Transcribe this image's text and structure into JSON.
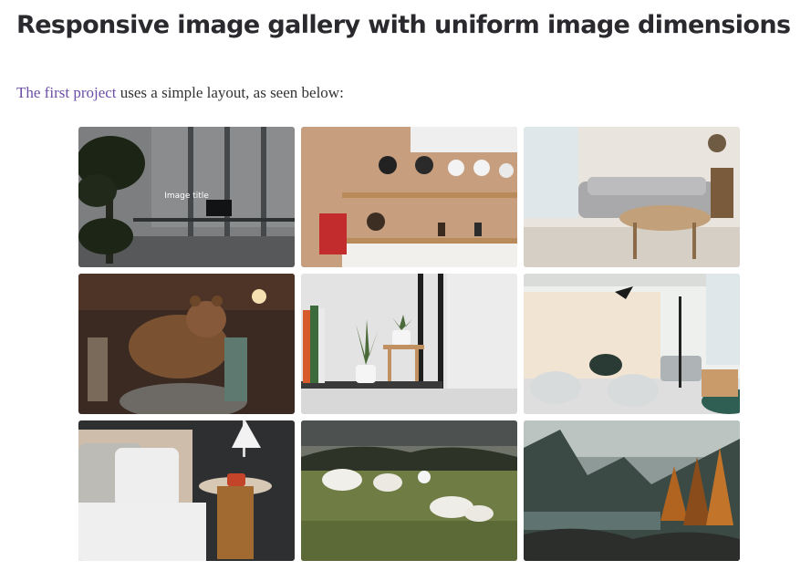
{
  "page": {
    "heading": "Responsive image gallery with uniform image dimensions",
    "intro_link": "The first project",
    "intro_text": " uses a simple layout, as seen below:"
  },
  "gallery": {
    "hover_caption": "Image title",
    "images": [
      {
        "subject": "office with potted palm and glass railing",
        "hovered": true
      },
      {
        "subject": "shop wall with hats on shelves"
      },
      {
        "subject": "bright living room with grey sofa and round table"
      },
      {
        "subject": "brown bear taxidermy in museum"
      },
      {
        "subject": "shelf with books and potted plants"
      },
      {
        "subject": "modern lounge with white chairs and floor lamp"
      },
      {
        "subject": "bedroom with nightstand and lamp"
      },
      {
        "subject": "sheep grazing on moorland"
      },
      {
        "subject": "autumn forest by mountain lake"
      }
    ]
  },
  "colors": {
    "link": "#6b4ea8",
    "heading": "#2a2a2e"
  }
}
